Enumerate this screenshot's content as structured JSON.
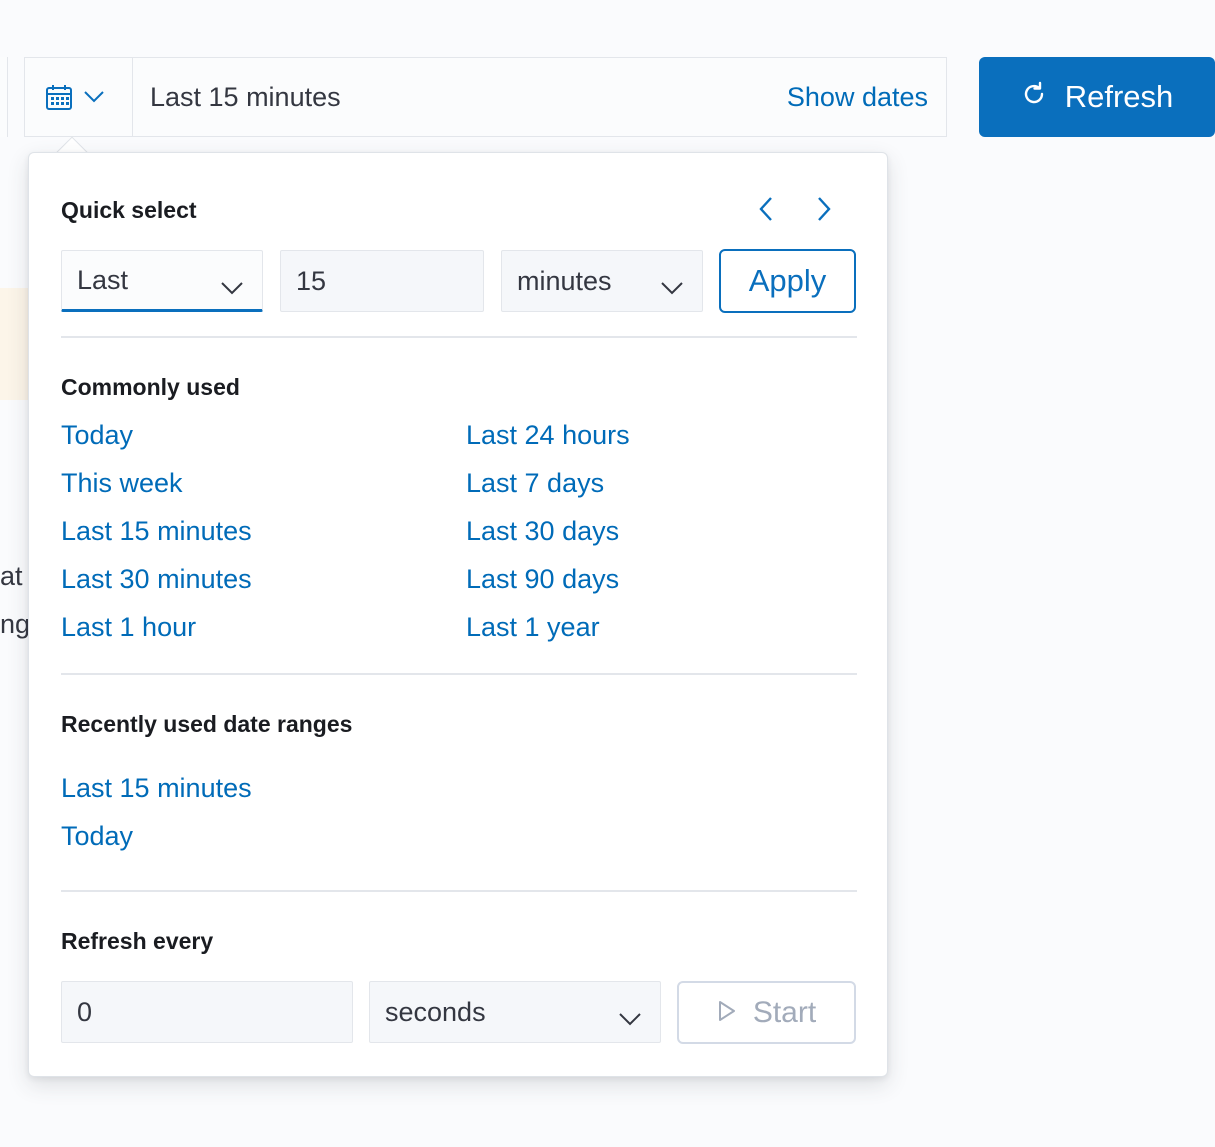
{
  "background": {
    "text_fragment_1": "at",
    "text_fragment_2": "ng"
  },
  "picker_bar": {
    "range_label": "Last 15 minutes",
    "show_dates_label": "Show dates",
    "refresh_label": "Refresh"
  },
  "quick_select": {
    "title": "Quick select",
    "direction_value": "Last",
    "amount_value": "15",
    "unit_value": "minutes",
    "apply_label": "Apply"
  },
  "commonly_used": {
    "title": "Commonly used",
    "left_column": [
      "Today",
      "This week",
      "Last 15 minutes",
      "Last 30 minutes",
      "Last 1 hour"
    ],
    "right_column": [
      "Last 24 hours",
      "Last 7 days",
      "Last 30 days",
      "Last 90 days",
      "Last 1 year"
    ]
  },
  "recently_used": {
    "title": "Recently used date ranges",
    "items": [
      "Last 15 minutes",
      "Today"
    ]
  },
  "refresh_every": {
    "title": "Refresh every",
    "interval_value": "0",
    "unit_value": "seconds",
    "start_label": "Start"
  },
  "colors": {
    "primary": "#0a6fbd",
    "link": "#006bb8",
    "disabled": "#a2abba",
    "warning_callout": "#fcf5e9"
  }
}
